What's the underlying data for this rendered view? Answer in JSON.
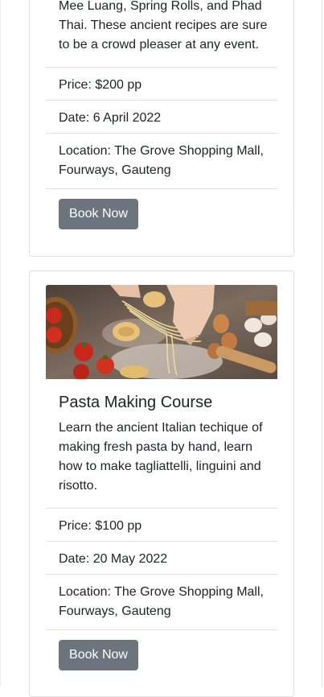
{
  "cards": [
    {
      "description_tail": "Mee Luang, Spring Rolls, and Phad Thai. These ancient recipes are sure to be a crowd pleaser at any event.",
      "price": "Price: $200 pp",
      "date": "Date: 6 April 2022",
      "location": "Location: The Grove Shopping Mall, Fourways, Gauteng",
      "button_label": "Book Now"
    },
    {
      "title": "Pasta Making Course",
      "description": "Learn the ancient Italian techique of making fresh pasta by hand, learn how to make tagliattelli, linguini and risotto.",
      "price": "Price: $100 pp",
      "date": "Date: 20 May 2022",
      "location": "Location: The Grove Shopping Mall, Fourways, Gauteng",
      "button_label": "Book Now"
    }
  ]
}
